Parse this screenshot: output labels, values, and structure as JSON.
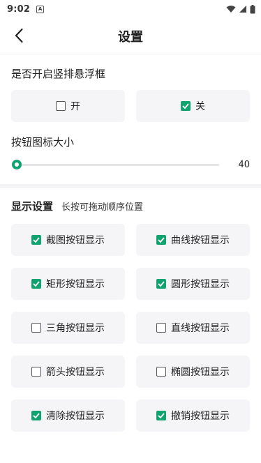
{
  "status_bar": {
    "time": "9:02",
    "a_icon": "A"
  },
  "header": {
    "title": "设置"
  },
  "floating": {
    "label": "是否开启竖排悬浮框",
    "options": [
      {
        "label": "开",
        "checked": false
      },
      {
        "label": "关",
        "checked": true
      }
    ]
  },
  "icon_size": {
    "label": "按钮图标大小",
    "value": "40",
    "level": 0
  },
  "display": {
    "title": "显示设置",
    "hint": "长按可拖动顺序位置",
    "items": [
      {
        "label": "截图按钮显示",
        "checked": true
      },
      {
        "label": "曲线按钮显示",
        "checked": true
      },
      {
        "label": "矩形按钮显示",
        "checked": true
      },
      {
        "label": "圆形按钮显示",
        "checked": true
      },
      {
        "label": "三角按钮显示",
        "checked": false
      },
      {
        "label": "直线按钮显示",
        "checked": false
      },
      {
        "label": "箭头按钮显示",
        "checked": false
      },
      {
        "label": "椭圆按钮显示",
        "checked": false
      },
      {
        "label": "清除按钮显示",
        "checked": true
      },
      {
        "label": "撤销按钮显示",
        "checked": true
      }
    ]
  },
  "colors": {
    "accent": "#11a36f",
    "option_bg": "#f5f5f7"
  }
}
